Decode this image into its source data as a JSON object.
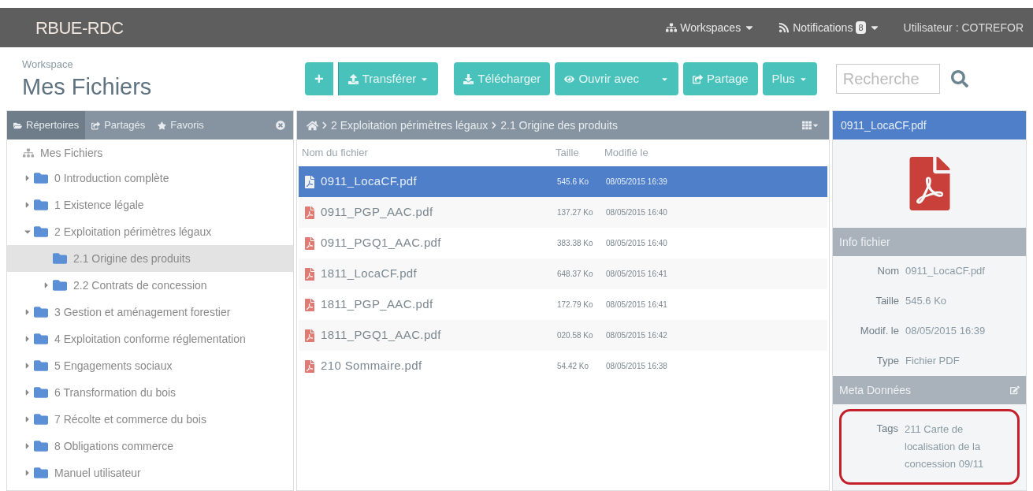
{
  "navbar": {
    "brand": "RBUE-RDC",
    "menus": [
      {
        "label": "Workspaces"
      },
      {
        "label": "Notifications",
        "badge": "8"
      }
    ],
    "user": "Utilisateur : COTREFOR"
  },
  "header": {
    "overline": "Workspace",
    "title": "Mes Fichiers"
  },
  "toolbar": {
    "buttons": [
      {
        "label": "+",
        "kind": "plain"
      },
      {
        "label": "Transférer",
        "kind": "dropdown"
      },
      {
        "label": "Télécharger",
        "kind": "plain"
      },
      {
        "label": "Ouvrir avec",
        "kind": "split"
      },
      {
        "label": "Partage",
        "kind": "plain"
      },
      {
        "label": "Plus",
        "kind": "dropdown"
      }
    ],
    "search": {
      "placeholder": "Recherche"
    }
  },
  "sidebar": {
    "tabs": [
      {
        "label": "Répertoires",
        "selected": true
      },
      {
        "label": "Partagés",
        "selected": false
      },
      {
        "label": "Favoris",
        "selected": false
      }
    ],
    "root": "Mes Fichiers",
    "tree": [
      {
        "label": "0 Introduction complète",
        "kind": "branch",
        "expanded": false,
        "selected": false
      },
      {
        "label": "1 Existence légale",
        "kind": "branch",
        "expanded": false,
        "selected": false
      },
      {
        "label": "2 Exploitation périmètres légaux",
        "kind": "branch",
        "expanded": true,
        "selected": false,
        "children": [
          {
            "label": "2.1 Origine des produits",
            "kind": "leaf",
            "expanded": false,
            "selected": true
          },
          {
            "label": "2.2 Contrats de concession",
            "kind": "branch",
            "expanded": false,
            "selected": false
          }
        ]
      },
      {
        "label": "3 Gestion et aménagement forestier",
        "kind": "branch",
        "expanded": false,
        "selected": false
      },
      {
        "label": "4 Exploitation conforme réglementation",
        "kind": "branch",
        "expanded": false,
        "selected": false
      },
      {
        "label": "5 Engagements sociaux",
        "kind": "branch",
        "expanded": false,
        "selected": false
      },
      {
        "label": "6 Transformation du bois",
        "kind": "branch",
        "expanded": false,
        "selected": false
      },
      {
        "label": "7 Récolte et commerce du bois",
        "kind": "branch",
        "expanded": false,
        "selected": false
      },
      {
        "label": "8 Obligations commerce",
        "kind": "branch",
        "expanded": false,
        "selected": false
      },
      {
        "label": "Manuel utilisateur",
        "kind": "branch",
        "expanded": false,
        "selected": false
      }
    ]
  },
  "breadcrumb": [
    "2 Exploitation périmètres légaux",
    "2.1 Origine des produits"
  ],
  "table": {
    "columns": [
      "Nom du fichier",
      "Taille",
      "Modifié le"
    ],
    "rows": [
      {
        "name": "0911_LocaCF.pdf",
        "size": "545.6 Ko",
        "modified": "08/05/2015 16:39",
        "selected": true
      },
      {
        "name": "0911_PGP_AAC.pdf",
        "size": "137.27 Ko",
        "modified": "08/05/2015 16:40",
        "selected": false
      },
      {
        "name": "0911_PGQ1_AAC.pdf",
        "size": "383.38 Ko",
        "modified": "08/05/2015 16:40",
        "selected": false
      },
      {
        "name": "1811_LocaCF.pdf",
        "size": "648.37 Ko",
        "modified": "08/05/2015 16:41",
        "selected": false
      },
      {
        "name": "1811_PGP_AAC.pdf",
        "size": "172.79 Ko",
        "modified": "08/05/2015 16:41",
        "selected": false
      },
      {
        "name": "1811_PGQ1_AAC.pdf",
        "size": "020.58 Ko",
        "modified": "08/05/2015 16:42",
        "selected": false
      },
      {
        "name": "210 Sommaire.pdf",
        "size": "54.42 Ko",
        "modified": "08/05/2015 16:38",
        "selected": false
      }
    ]
  },
  "details": {
    "title": "0911_LocaCF.pdf",
    "info": {
      "heading": "Info fichier",
      "fields": [
        {
          "label": "Nom",
          "value": "0911_LocaCF.pdf"
        },
        {
          "label": "Taille",
          "value": "545.6 Ko"
        },
        {
          "label": "Modif. le",
          "value": "08/05/2015 16:39"
        },
        {
          "label": "Type",
          "value": "Fichier PDF"
        }
      ]
    },
    "meta": {
      "heading": "Meta Données",
      "fields": [
        {
          "label": "Tags",
          "value": "211 Carte de localisation de la concession 09/11",
          "highlighted": true
        }
      ]
    }
  }
}
